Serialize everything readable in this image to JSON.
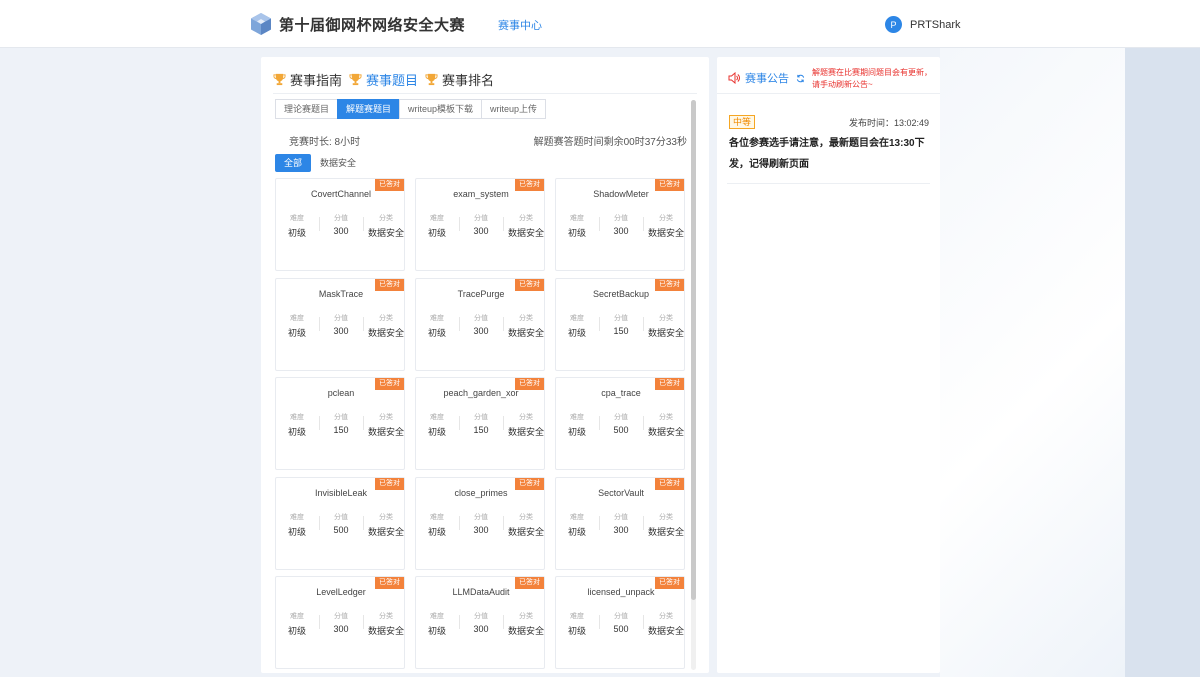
{
  "header": {
    "logo_icon": "cube-logo-icon",
    "title": "第十届御网杯网络安全大赛",
    "nav_label": "赛事中心",
    "user_initial": "P",
    "username": "PRTShark"
  },
  "section_tabs": [
    {
      "label": "赛事指南",
      "icon": "trophy-icon",
      "active": false
    },
    {
      "label": "赛事题目",
      "icon": "trophy-icon",
      "active": true
    },
    {
      "label": "赛事排名",
      "icon": "trophy-icon",
      "active": false
    }
  ],
  "sub_tabs": [
    {
      "label": "理论赛题目",
      "active": false
    },
    {
      "label": "解题赛题目",
      "active": true
    },
    {
      "label": "writeup模板下载",
      "active": false
    },
    {
      "label": "writeup上传",
      "active": false
    }
  ],
  "duration": "竞赛时长: 8小时",
  "countdown": "解题赛答题时间剩余00时37分33秒",
  "category_tabs": [
    {
      "label": "全部",
      "active": true
    },
    {
      "label": "数据安全",
      "active": false
    }
  ],
  "card_labels": {
    "badge": "已答对",
    "difficulty": "难度",
    "score": "分值",
    "category": "分类"
  },
  "challenges": [
    {
      "name": "CovertChannel",
      "difficulty": "初级",
      "score": "300",
      "category": "数据安全"
    },
    {
      "name": "exam_system",
      "difficulty": "初级",
      "score": "300",
      "category": "数据安全"
    },
    {
      "name": "ShadowMeter",
      "difficulty": "初级",
      "score": "300",
      "category": "数据安全"
    },
    {
      "name": "MaskTrace",
      "difficulty": "初级",
      "score": "300",
      "category": "数据安全"
    },
    {
      "name": "TracePurge",
      "difficulty": "初级",
      "score": "300",
      "category": "数据安全"
    },
    {
      "name": "SecretBackup",
      "difficulty": "初级",
      "score": "150",
      "category": "数据安全"
    },
    {
      "name": "pclean",
      "difficulty": "初级",
      "score": "150",
      "category": "数据安全"
    },
    {
      "name": "peach_garden_xor",
      "difficulty": "初级",
      "score": "150",
      "category": "数据安全"
    },
    {
      "name": "cpa_trace",
      "difficulty": "初级",
      "score": "500",
      "category": "数据安全"
    },
    {
      "name": "InvisibleLeak",
      "difficulty": "初级",
      "score": "500",
      "category": "数据安全"
    },
    {
      "name": "close_primes",
      "difficulty": "初级",
      "score": "300",
      "category": "数据安全"
    },
    {
      "name": "SectorVault",
      "difficulty": "初级",
      "score": "300",
      "category": "数据安全"
    },
    {
      "name": "LevelLedger",
      "difficulty": "初级",
      "score": "300",
      "category": "数据安全"
    },
    {
      "name": "LLMDataAudit",
      "difficulty": "初级",
      "score": "300",
      "category": "数据安全"
    },
    {
      "name": "licensed_unpack",
      "difficulty": "初级",
      "score": "500",
      "category": "数据安全"
    }
  ],
  "notice": {
    "speaker_icon": "speaker-icon",
    "refresh_icon": "refresh-icon",
    "title": "赛事公告",
    "warning": "解题赛在比赛期间题目会有更新，请手动刷新公告~",
    "level": "中等",
    "time": "发布时间：13:02:49",
    "body": "各位参赛选手请注意，最新题目会在13:30下发，记得刷新页面"
  },
  "colors": {
    "accent": "#2d86e6",
    "badge": "#f3823b",
    "warning": "#e8322e",
    "level": "#f08a00"
  }
}
